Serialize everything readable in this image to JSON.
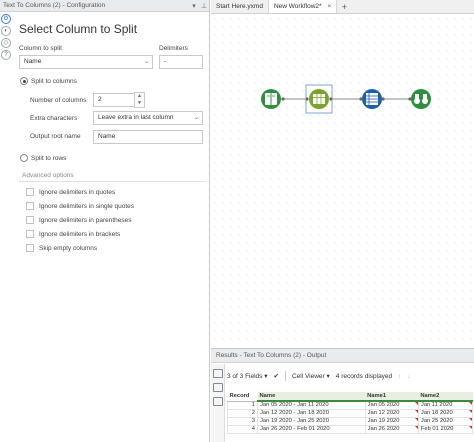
{
  "config": {
    "title_bar": "Text To Columns (2) - Configuration",
    "heading": "Select Column to Split",
    "column_label": "Column to split",
    "column_value": "Name",
    "delimiters_label": "Delimiters",
    "delimiters_value": "-",
    "split_columns_label": "Split to columns",
    "num_columns_label": "Number of columns",
    "num_columns_value": "2",
    "extra_chars_label": "Extra characters",
    "extra_chars_value": "Leave extra in last column",
    "output_root_label": "Output root name",
    "output_root_value": "Name",
    "split_rows_label": "Split to rows",
    "advanced_label": "Advanced options",
    "options": [
      "Ignore delimiters in quotes",
      "Ignore delimiters in single quotes",
      "Ignore delimiters in parentheses",
      "Ignore delimiters in brackets",
      "Skip empty columns"
    ]
  },
  "tabs": [
    {
      "label": "Start Here.yxmd"
    },
    {
      "label": "New Workflow2*",
      "close": "×"
    }
  ],
  "tab_add": "+",
  "workflow": {
    "tools": [
      {
        "name": "input-data-tool",
        "color": "#2f8f3f"
      },
      {
        "name": "text-to-columns-tool",
        "color": "#7aa329"
      },
      {
        "name": "formula-tool",
        "color": "#1f5fa8"
      },
      {
        "name": "browse-tool",
        "color": "#2f8f3f"
      }
    ]
  },
  "results": {
    "title": "Results - Text To Columns (2) - Output",
    "fields": "3 of 3 Fields",
    "viewer": "Cell Viewer",
    "records": "4 records displayed",
    "columns": [
      "Record",
      "Name",
      "Name1",
      "Name2"
    ],
    "rows": [
      [
        "1",
        "Jan 05 2020 - Jan 11 2020",
        "Jan 05 2020",
        "Jan 11 2020"
      ],
      [
        "2",
        "Jan 12 2020 - Jan 18 2020",
        "Jan 12 2020",
        "Jan 18 2020"
      ],
      [
        "3",
        "Jan 19 2020 - Jan 25 2020",
        "Jan 19 2020",
        "Jan 25 2020"
      ],
      [
        "4",
        "Jan 26 2020 - Feb 01 2020",
        "Jan 26 2020",
        "Feb 01 2020"
      ]
    ]
  }
}
